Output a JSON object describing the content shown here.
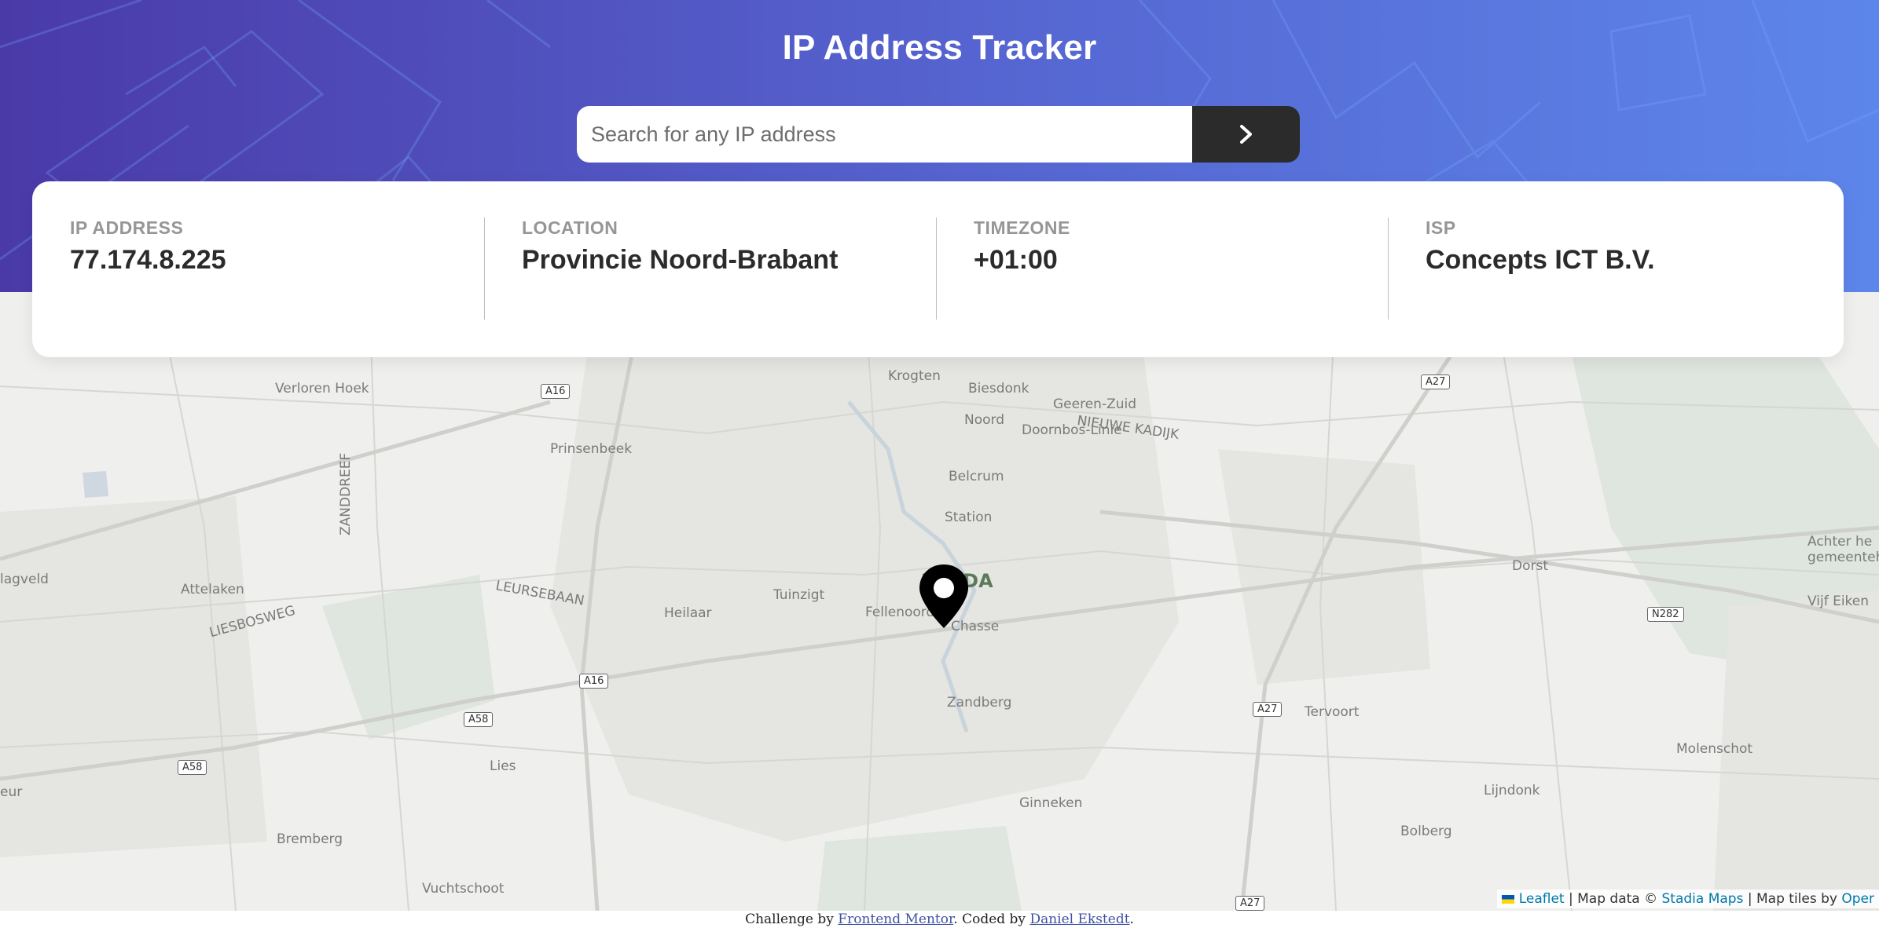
{
  "header": {
    "title": "IP Address Tracker",
    "search_placeholder": "Search for any IP address"
  },
  "info": [
    {
      "label": "IP ADDRESS",
      "value": "77.174.8.225"
    },
    {
      "label": "LOCATION",
      "value": "Provincie Noord-Brabant"
    },
    {
      "label": "TIMEZONE",
      "value": "+01:00"
    },
    {
      "label": "ISP",
      "value": "Concepts ICT B.V."
    }
  ],
  "map": {
    "labels": [
      "Verloren Hoek",
      "Krogten",
      "Biesdonk",
      "Geeren-Zuid",
      "Noord",
      "NIEUWE KADIJK",
      "Prinsenbeek",
      "Doornbos-Linie",
      "Belcrum",
      "Station",
      "ZANDDREEF",
      "lagveld",
      "Attelaken",
      "LEURSEBAAN",
      "Tuinzigt",
      "Heilaar",
      "Fellenoord",
      "Chasse",
      "LIESBOSWEG",
      "Zandberg",
      "Lies",
      "Tervoort",
      "Molenschot",
      "Lijndonk",
      "Ginneken",
      "Bolberg",
      "Bremberg",
      "Vuchtschoot",
      "Dorst",
      "Achter he gemeenteh",
      "Vijf Eiken",
      "eur",
      "BREDA"
    ],
    "road_shields": [
      "A16",
      "A16",
      "A58",
      "A58",
      "A27",
      "A27",
      "A27",
      "N282"
    ]
  },
  "attribution": {
    "leaflet": "Leaflet",
    "sep1": " | Map data © ",
    "stadia": "Stadia Maps",
    "sep2": " | Map tiles by ",
    "tiles_link": "Oper"
  },
  "footer": {
    "prefix": "Challenge by ",
    "frontend_mentor": "Frontend Mentor",
    "middle": ". Coded by ",
    "author": "Daniel Ekstedt",
    "suffix": "."
  },
  "colors": {
    "header_gradient_start": "#4a3aa8",
    "header_gradient_end": "#5d86ea",
    "button_dark": "#2b2b2b",
    "map_background": "#efefed"
  }
}
